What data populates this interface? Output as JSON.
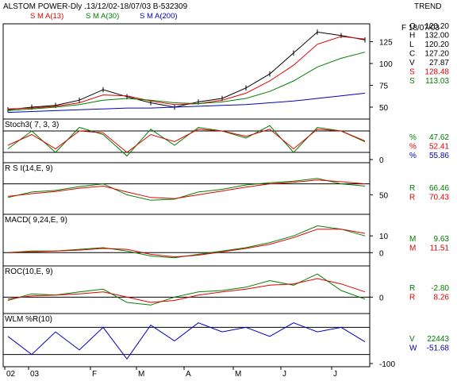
{
  "header": {
    "title": "ALSTOM POWER-Dly .13/12/02-18/07/03  B-532309",
    "sma13_label": "S M A(13)",
    "sma30_label": "S M A(30)",
    "sma200_label": "S M A(200)",
    "trend_label": "TREND",
    "date_label": "F 18/07/03"
  },
  "colors": {
    "sma13": "#e00000",
    "sma30": "#008000",
    "sma200": "#0000c0",
    "price": "#000000",
    "stoch_k": "#008000",
    "stoch_d": "#e00000",
    "stoch_slow": "#0000c0",
    "panel_border": "#000000"
  },
  "panels": [
    {
      "id": "price",
      "label": "",
      "ticks": [
        "125",
        "100",
        "75",
        "50"
      ],
      "stats": [
        {
          "label": "O",
          "value": "120.20",
          "color": "#000000"
        },
        {
          "label": "H",
          "value": "132.00",
          "color": "#000000"
        },
        {
          "label": "L",
          "value": "120.20",
          "color": "#000000"
        },
        {
          "label": "C",
          "value": "127.20",
          "color": "#000000"
        },
        {
          "label": "V",
          "value": "27.87",
          "color": "#000000"
        },
        {
          "label": "S",
          "value": "128.48",
          "color": "#e00000"
        },
        {
          "label": "S",
          "value": "113.03",
          "color": "#008000"
        }
      ]
    },
    {
      "id": "stoch",
      "label": "Stoch3( 7, 3, 3)",
      "ticks": [
        "0"
      ],
      "stats": [
        {
          "label": "%",
          "value": "47.62",
          "color": "#008000"
        },
        {
          "label": "%",
          "value": "52.41",
          "color": "#e00000"
        },
        {
          "label": "%",
          "value": "55.86",
          "color": "#0000c0"
        }
      ]
    },
    {
      "id": "rsi",
      "label": "R S I(14,E, 9)",
      "ticks": [
        "50"
      ],
      "stats": [
        {
          "label": "R",
          "value": "66.46",
          "color": "#008000"
        },
        {
          "label": "R",
          "value": "70.43",
          "color": "#e00000"
        }
      ]
    },
    {
      "id": "macd",
      "label": "MACD( 9,24,E, 9)",
      "ticks": [
        "10",
        "0"
      ],
      "stats": [
        {
          "label": "M",
          "value": "9.63",
          "color": "#008000"
        },
        {
          "label": "M",
          "value": "11.51",
          "color": "#e00000"
        }
      ]
    },
    {
      "id": "roc",
      "label": "ROC(10,E, 9)",
      "ticks": [
        "0"
      ],
      "stats": [
        {
          "label": "R",
          "value": "-2.80",
          "color": "#008000"
        },
        {
          "label": "R",
          "value": "8.26",
          "color": "#e00000"
        }
      ]
    },
    {
      "id": "wlm",
      "label": "WLM %R(10)",
      "ticks": [
        "-100"
      ],
      "stats": [
        {
          "label": "V",
          "value": "22443",
          "color": "#008000"
        },
        {
          "label": "W",
          "value": "-51.68",
          "color": "#0000c0"
        }
      ]
    }
  ],
  "x_axis": {
    "labels": [
      "02",
      "03",
      "F",
      "M",
      "A",
      "M",
      "J",
      "J"
    ]
  },
  "chart_data": {
    "type": "line",
    "title": "ALSTOM POWER-Dly .13/12/02-18/07/03  B-532309",
    "x": [
      "Dec-02",
      "Jan-03",
      "Jan-03",
      "Feb-03",
      "Feb-03",
      "Mar-03",
      "Mar-03",
      "Apr-03",
      "Apr-03",
      "May-03",
      "May-03",
      "Jun-03",
      "Jun-03",
      "Jul-03",
      "Jul-03",
      "Jul-03"
    ],
    "price_close": [
      47,
      50,
      52,
      58,
      70,
      62,
      55,
      50,
      56,
      60,
      72,
      88,
      112,
      136,
      132,
      127
    ],
    "sma13": [
      48,
      49,
      51,
      55,
      64,
      63,
      57,
      53,
      54,
      58,
      66,
      80,
      98,
      122,
      131,
      128
    ],
    "sma30": [
      46,
      48,
      50,
      53,
      58,
      60,
      58,
      55,
      54,
      56,
      60,
      68,
      80,
      96,
      106,
      113
    ],
    "sma200": [
      44,
      45,
      46,
      47,
      48,
      49,
      49,
      50,
      51,
      52,
      53,
      55,
      57,
      60,
      63,
      66
    ],
    "stoch_k": [
      30,
      80,
      20,
      90,
      70,
      10,
      85,
      40,
      90,
      80,
      60,
      95,
      20,
      90,
      80,
      50
    ],
    "stoch_d": [
      40,
      70,
      30,
      80,
      75,
      20,
      70,
      50,
      85,
      80,
      65,
      85,
      30,
      85,
      80,
      52
    ],
    "rsi": [
      45,
      55,
      58,
      65,
      70,
      50,
      40,
      42,
      55,
      60,
      68,
      72,
      75,
      80,
      70,
      66
    ],
    "rsi_signal": [
      47,
      52,
      56,
      62,
      66,
      55,
      45,
      43,
      50,
      57,
      64,
      70,
      73,
      77,
      74,
      70
    ],
    "macd": [
      0,
      1,
      1,
      2,
      3,
      1,
      -2,
      -3,
      -1,
      1,
      3,
      6,
      10,
      16,
      14,
      10
    ],
    "macd_signal": [
      0,
      0.5,
      1,
      1.5,
      2.5,
      2,
      -1,
      -2.5,
      -1.5,
      0.5,
      2.5,
      5,
      9,
      14,
      14,
      11.5
    ],
    "roc": [
      -5,
      5,
      3,
      8,
      12,
      -8,
      -12,
      0,
      8,
      10,
      15,
      25,
      18,
      35,
      10,
      -3
    ],
    "roc_signal": [
      -3,
      2,
      3,
      5,
      8,
      0,
      -8,
      -5,
      3,
      8,
      12,
      18,
      20,
      28,
      20,
      8
    ],
    "wlm": [
      -40,
      -80,
      -30,
      -70,
      -20,
      -90,
      -15,
      -50,
      -10,
      -30,
      -20,
      -40,
      -10,
      -30,
      -20,
      -52
    ],
    "xlabel": "",
    "ylabel": "",
    "ylim_price": [
      40,
      140
    ]
  }
}
